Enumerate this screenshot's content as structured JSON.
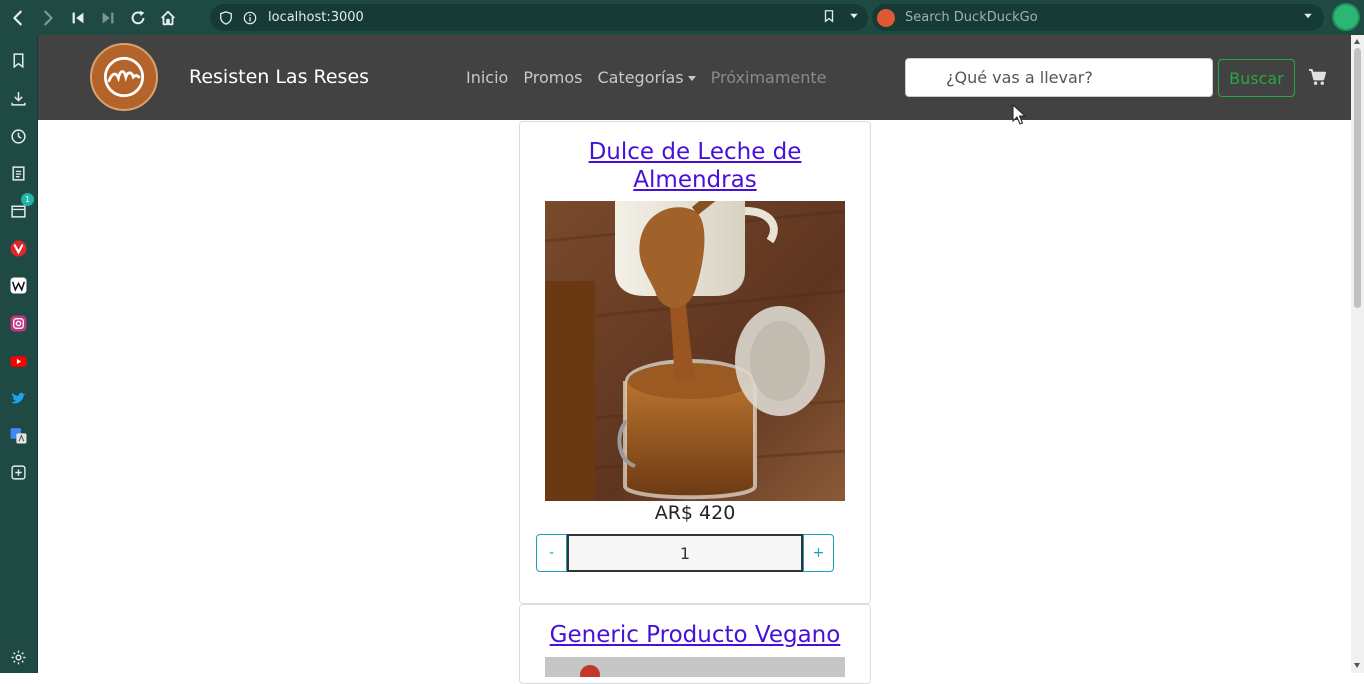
{
  "browser": {
    "url": "localhost:3000",
    "search_placeholder": "Search DuckDuckGo",
    "sidebar_badge": "1"
  },
  "navbar": {
    "brand": "Resisten Las Reses",
    "links": [
      "Inicio",
      "Promos",
      "Categorías",
      "Próximamente"
    ],
    "search_placeholder": "¿Qué vas a llevar?",
    "search_button": "Buscar"
  },
  "products": [
    {
      "title_line1": "Dulce de Leche de",
      "title_line2": "Almendras",
      "price": "AR$ 420",
      "quantity": "1",
      "minus": "-",
      "plus": "+"
    },
    {
      "title": "Generic Producto Vegano"
    }
  ],
  "colors": {
    "browser_chrome": "#1f4a44",
    "navbar": "#424242",
    "link": "#4710d8",
    "success": "#28a745",
    "info": "#17a2b8"
  }
}
